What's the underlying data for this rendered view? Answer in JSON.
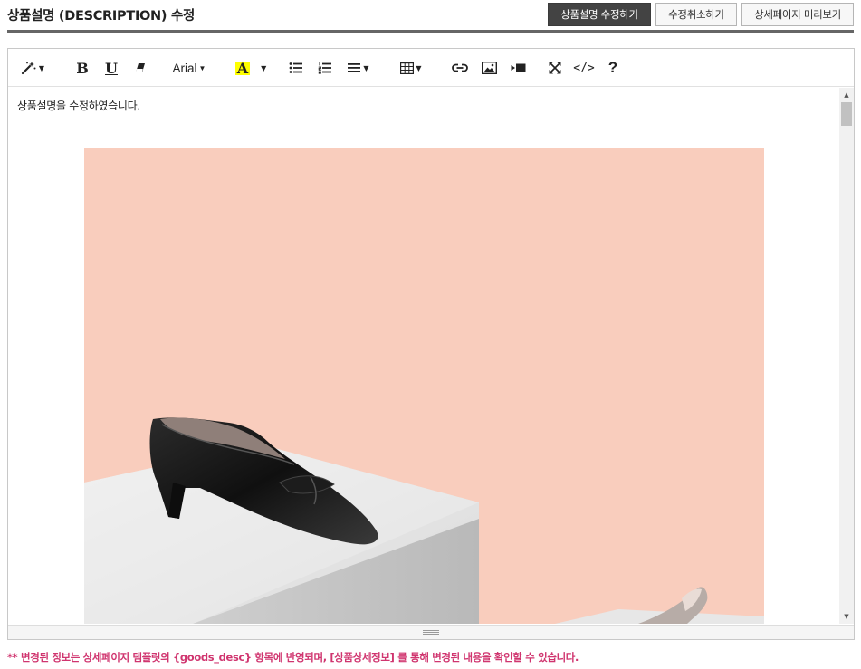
{
  "header": {
    "title": "상품설명 (DESCRIPTION) 수정",
    "buttons": {
      "save": "상품설명 수정하기",
      "cancel": "수정취소하기",
      "preview": "상세페이지 미리보기"
    }
  },
  "toolbar": {
    "items": [
      {
        "name": "magic-wand-style",
        "icon": "magic-wand-icon"
      },
      {
        "name": "bold",
        "label": "B"
      },
      {
        "name": "underline",
        "label": "U"
      },
      {
        "name": "eraser",
        "icon": "eraser-icon"
      },
      {
        "name": "font-family",
        "label": "Arial"
      },
      {
        "name": "font-color",
        "label": "A",
        "highlight_color": "#ffff00"
      },
      {
        "name": "unordered-list",
        "icon": "bullet-list-icon"
      },
      {
        "name": "ordered-list",
        "icon": "numbered-list-icon"
      },
      {
        "name": "align",
        "icon": "align-icon"
      },
      {
        "name": "table",
        "icon": "table-icon"
      },
      {
        "name": "link",
        "icon": "link-icon"
      },
      {
        "name": "picture",
        "icon": "image-icon"
      },
      {
        "name": "video",
        "icon": "video-icon"
      },
      {
        "name": "fullscreen",
        "icon": "fullscreen-icon"
      },
      {
        "name": "code-view",
        "label": "</>"
      },
      {
        "name": "help",
        "label": "?"
      }
    ]
  },
  "editor": {
    "content_text": "상품설명을 수정하였습니다.",
    "image": {
      "icon": "product-shoe-photo",
      "background_color": "#f9cdbd"
    }
  },
  "notice": "** 변경된 정보는 상세페이지 템플릿의 {goods_desc} 항목에 반영되며, [상품상세정보] 를 통해 변경된 내용을 확인할 수 있습니다.",
  "colors": {
    "primary_button": "#434343",
    "notice_text": "#d0356f",
    "image_background": "#f9cdbd"
  }
}
